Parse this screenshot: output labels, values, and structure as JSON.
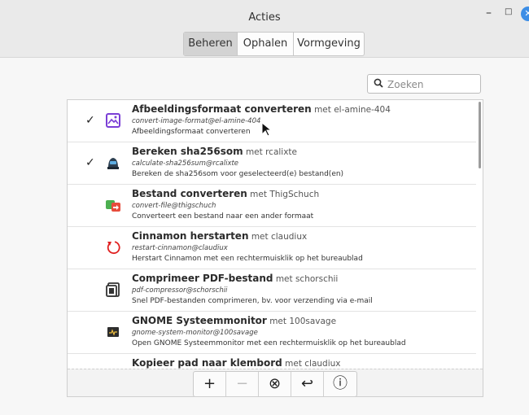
{
  "window": {
    "title": "Acties",
    "controls": {
      "minimize": "–",
      "maximize": "□",
      "close": "✕"
    }
  },
  "tabs": [
    {
      "label": "Beheren",
      "active": true
    },
    {
      "label": "Ophalen",
      "active": false
    },
    {
      "label": "Vormgeving",
      "active": false
    }
  ],
  "search": {
    "placeholder": "Zoeken",
    "value": ""
  },
  "actions": [
    {
      "title": "Afbeeldingsformaat converteren",
      "author": "met el-amine-404",
      "uuid": "convert-image-format@el-amine-404",
      "description": "Afbeeldingsformaat converteren",
      "enabled": true,
      "icon": "image-icon"
    },
    {
      "title": "Bereken sha256som",
      "author": "met rcalixte",
      "uuid": "calculate-sha256sum@rcalixte",
      "description": "Bereken de sha256som voor geselecteerd(e) bestand(en)",
      "enabled": true,
      "icon": "hacker-icon"
    },
    {
      "title": "Bestand converteren",
      "author": "met ThigSchuch",
      "uuid": "convert-file@thigschuch",
      "description": "Converteert een bestand naar een ander formaat",
      "enabled": false,
      "icon": "convert-icon"
    },
    {
      "title": "Cinnamon herstarten",
      "author": "met claudiux",
      "uuid": "restart-cinnamon@claudiux",
      "description": "Herstart Cinnamon met een rechtermuisklik op het bureaublad",
      "enabled": false,
      "icon": "restart-icon"
    },
    {
      "title": "Comprimeer PDF-bestand",
      "author": "met schorschii",
      "uuid": "pdf-compressor@schorschii",
      "description": "Snel PDF-bestanden comprimeren, bv. voor verzending via e-mail",
      "enabled": false,
      "icon": "compress-icon"
    },
    {
      "title": "GNOME Systeemmonitor",
      "author": "met 100savage",
      "uuid": "gnome-system-monitor@100savage",
      "description": "Open GNOME Systeemmonitor met een rechtermuisklik op het bureaublad",
      "enabled": false,
      "icon": "monitor-icon"
    },
    {
      "title": "Kopieer pad naar klembord",
      "author": "met claudiux",
      "uuid": "",
      "description": "",
      "enabled": false,
      "icon": "copy-icon"
    }
  ],
  "toolbar": {
    "add": "+",
    "remove": "−",
    "uninstall": "⊗",
    "restore": "↩",
    "info": "ⓘ"
  },
  "colors": {
    "selected_check": "#222222",
    "accent": "#3d8ee6"
  }
}
